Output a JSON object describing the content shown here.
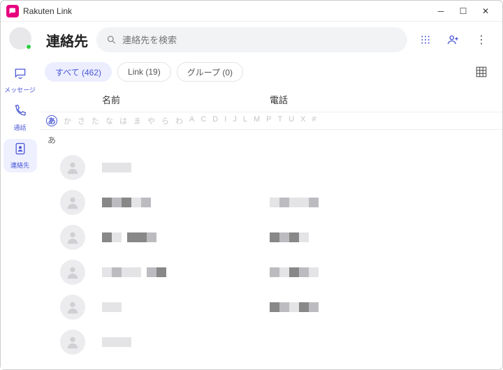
{
  "window": {
    "title": "Rakuten Link"
  },
  "sidebar": {
    "items": [
      {
        "label": "メッセージ"
      },
      {
        "label": "通話"
      },
      {
        "label": "連絡先"
      }
    ]
  },
  "header": {
    "title": "連絡先",
    "search_placeholder": "連絡先を検索"
  },
  "tabs": [
    {
      "label": "すべて (462)"
    },
    {
      "label": "Link (19)"
    },
    {
      "label": "グループ (0)"
    }
  ],
  "columns": {
    "name": "名前",
    "phone": "電話"
  },
  "index_letters": [
    "あ",
    "か",
    "さ",
    "た",
    "な",
    "は",
    "ま",
    "や",
    "ら",
    "わ",
    "A",
    "C",
    "D",
    "I",
    "J",
    "L",
    "M",
    "P",
    "T",
    "U",
    "X",
    "#"
  ],
  "section_letter": "あ"
}
